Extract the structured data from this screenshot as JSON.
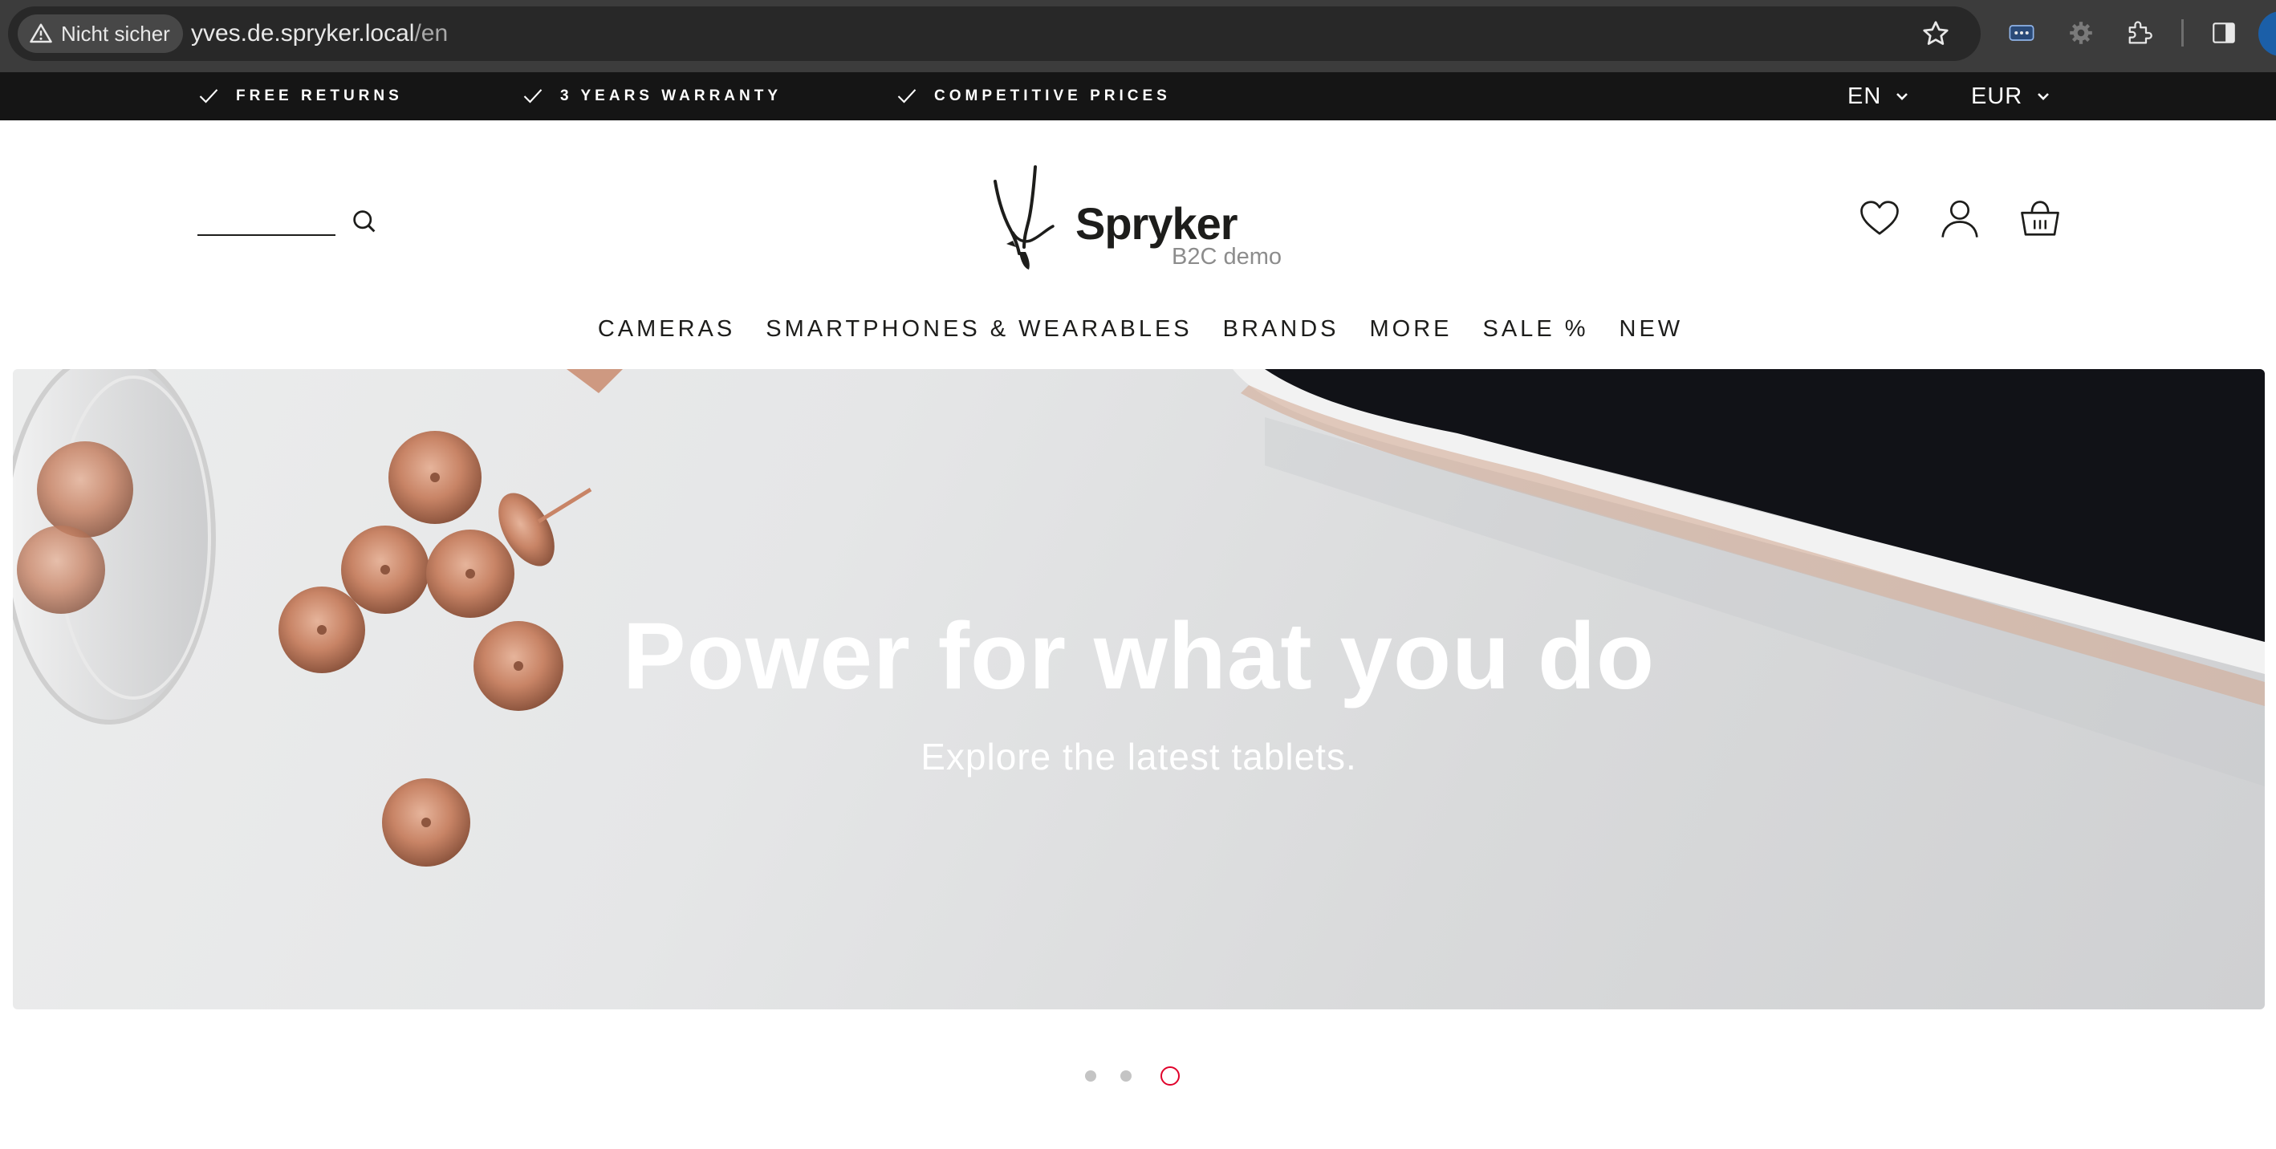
{
  "browser": {
    "security_label": "Nicht sicher",
    "url_host": "yves.de.spryker.local",
    "url_path": "/en"
  },
  "topbar": {
    "usps": [
      "FREE RETURNS",
      "3 YEARS WARRANTY",
      "COMPETITIVE PRICES"
    ],
    "language": "EN",
    "currency": "EUR"
  },
  "header": {
    "logo_word": "Spryker",
    "logo_sub": "B2C demo"
  },
  "nav": {
    "items": [
      "CAMERAS",
      "SMARTPHONES & WEARABLES",
      "BRANDS",
      "MORE",
      "SALE %",
      "NEW"
    ]
  },
  "hero": {
    "title": "Power for what you do",
    "subtitle": "Explore the latest tablets."
  },
  "slider": {
    "slide_count": 3,
    "active_slide": 3
  },
  "colors": {
    "topbar_bg": "#151515",
    "text": "#1d1d1b",
    "accent_active_dot": "#e0002a",
    "hero_text": "#ffffff"
  }
}
